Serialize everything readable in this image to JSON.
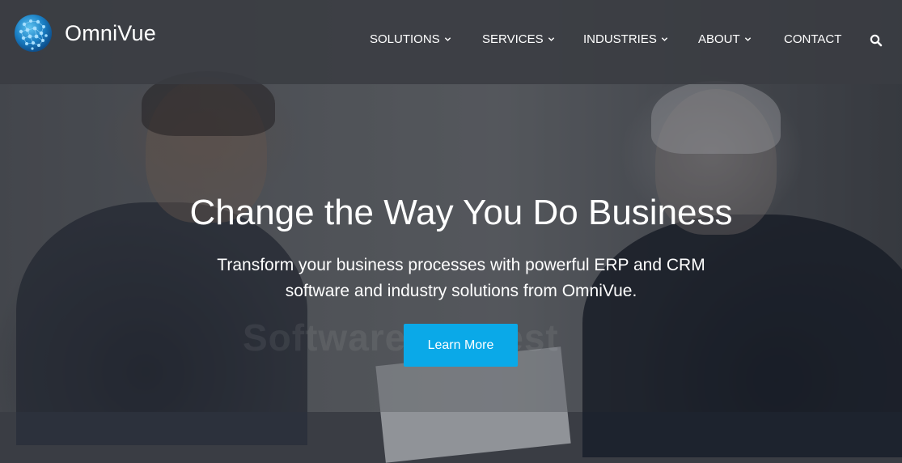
{
  "brand": {
    "name": "OmniVue",
    "logo_icon": "globe-network-icon"
  },
  "nav": {
    "items": [
      {
        "label": "SOLUTIONS",
        "has_dropdown": true
      },
      {
        "label": "SERVICES",
        "has_dropdown": true
      },
      {
        "label": "INDUSTRIES",
        "has_dropdown": true
      },
      {
        "label": "ABOUT",
        "has_dropdown": true
      },
      {
        "label": "CONTACT",
        "has_dropdown": false
      }
    ],
    "search_icon": "search-icon"
  },
  "hero": {
    "headline": "Change the Way You Do Business",
    "subtext_line1": "Transform your business processes with powerful ERP and CRM",
    "subtext_line2": "software and industry solutions from OmniVue.",
    "cta_label": "Learn More",
    "watermark": "SoftwareSuggest"
  },
  "colors": {
    "accent": "#0aa9e8",
    "header_bg": "#3a3c42",
    "text": "#ffffff"
  }
}
